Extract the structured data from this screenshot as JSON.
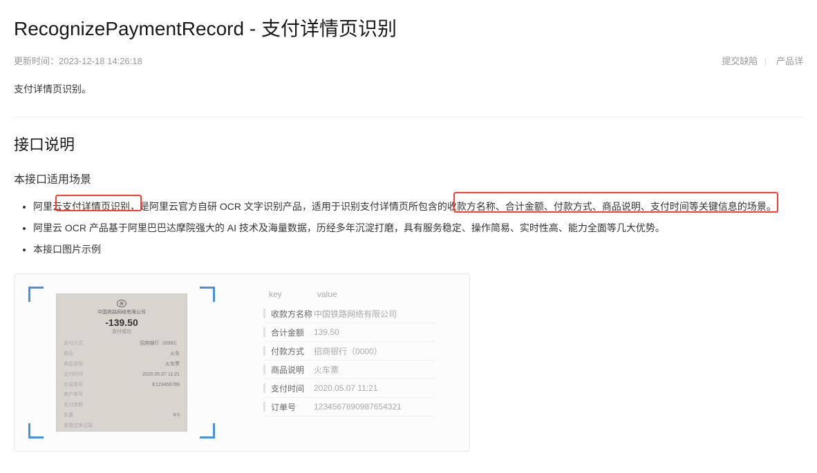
{
  "title": "RecognizePaymentRecord - 支付详情页识别",
  "meta": {
    "update_label": "更新时间：",
    "update_time": "2023-12-18 14:26:18",
    "link_defect": "提交缺陷",
    "link_product": "产品详"
  },
  "desc": "支付详情页识别。",
  "section_title": "接口说明",
  "sub_title": "本接口适用场景",
  "bullets": [
    "阿里云支付详情页识别，是阿里云官方自研 OCR 文字识别产品，适用于识别支付详情页所包含的收款方名称、合计金额、付款方式、商品说明、支付时间等关键信息的场景。",
    "阿里云 OCR 产品基于阿里巴巴达摩院强大的 AI 技术及海量数据，历经多年沉淀打磨，具有服务稳定、操作简易、实时性高、能力全面等几大优势。",
    "本接口图片示例"
  ],
  "receipt": {
    "company": "中国铁路网络有限公司",
    "amount": "-139.50",
    "sub": "支付成功",
    "rows": [
      {
        "k": "支付方式",
        "v": "招商银行（0000）"
      },
      {
        "k": "商品",
        "v": "火车"
      },
      {
        "k": "商品说明",
        "v": "火车票"
      },
      {
        "k": "支付时间",
        "v": "2020.05.07 11:21"
      },
      {
        "k": "交易单号",
        "v": "E123456789"
      },
      {
        "k": "商户单号",
        "v": ""
      },
      {
        "k": "支付金额",
        "v": ""
      },
      {
        "k": "优惠",
        "v": "￥0"
      },
      {
        "k": "查看往来记录",
        "v": ""
      }
    ]
  },
  "kv": {
    "key_label": "key",
    "value_label": "value",
    "rows": [
      {
        "k": "收款方名称",
        "v": "中国铁路网络有限公司"
      },
      {
        "k": "合计金额",
        "v": "139.50"
      },
      {
        "k": "付款方式",
        "v": "招商银行（0000）"
      },
      {
        "k": "商品说明",
        "v": "火车票"
      },
      {
        "k": "支付时间",
        "v": "2020.05.07 11:21"
      },
      {
        "k": "订单号",
        "v": "12345678909876​54321"
      }
    ]
  }
}
